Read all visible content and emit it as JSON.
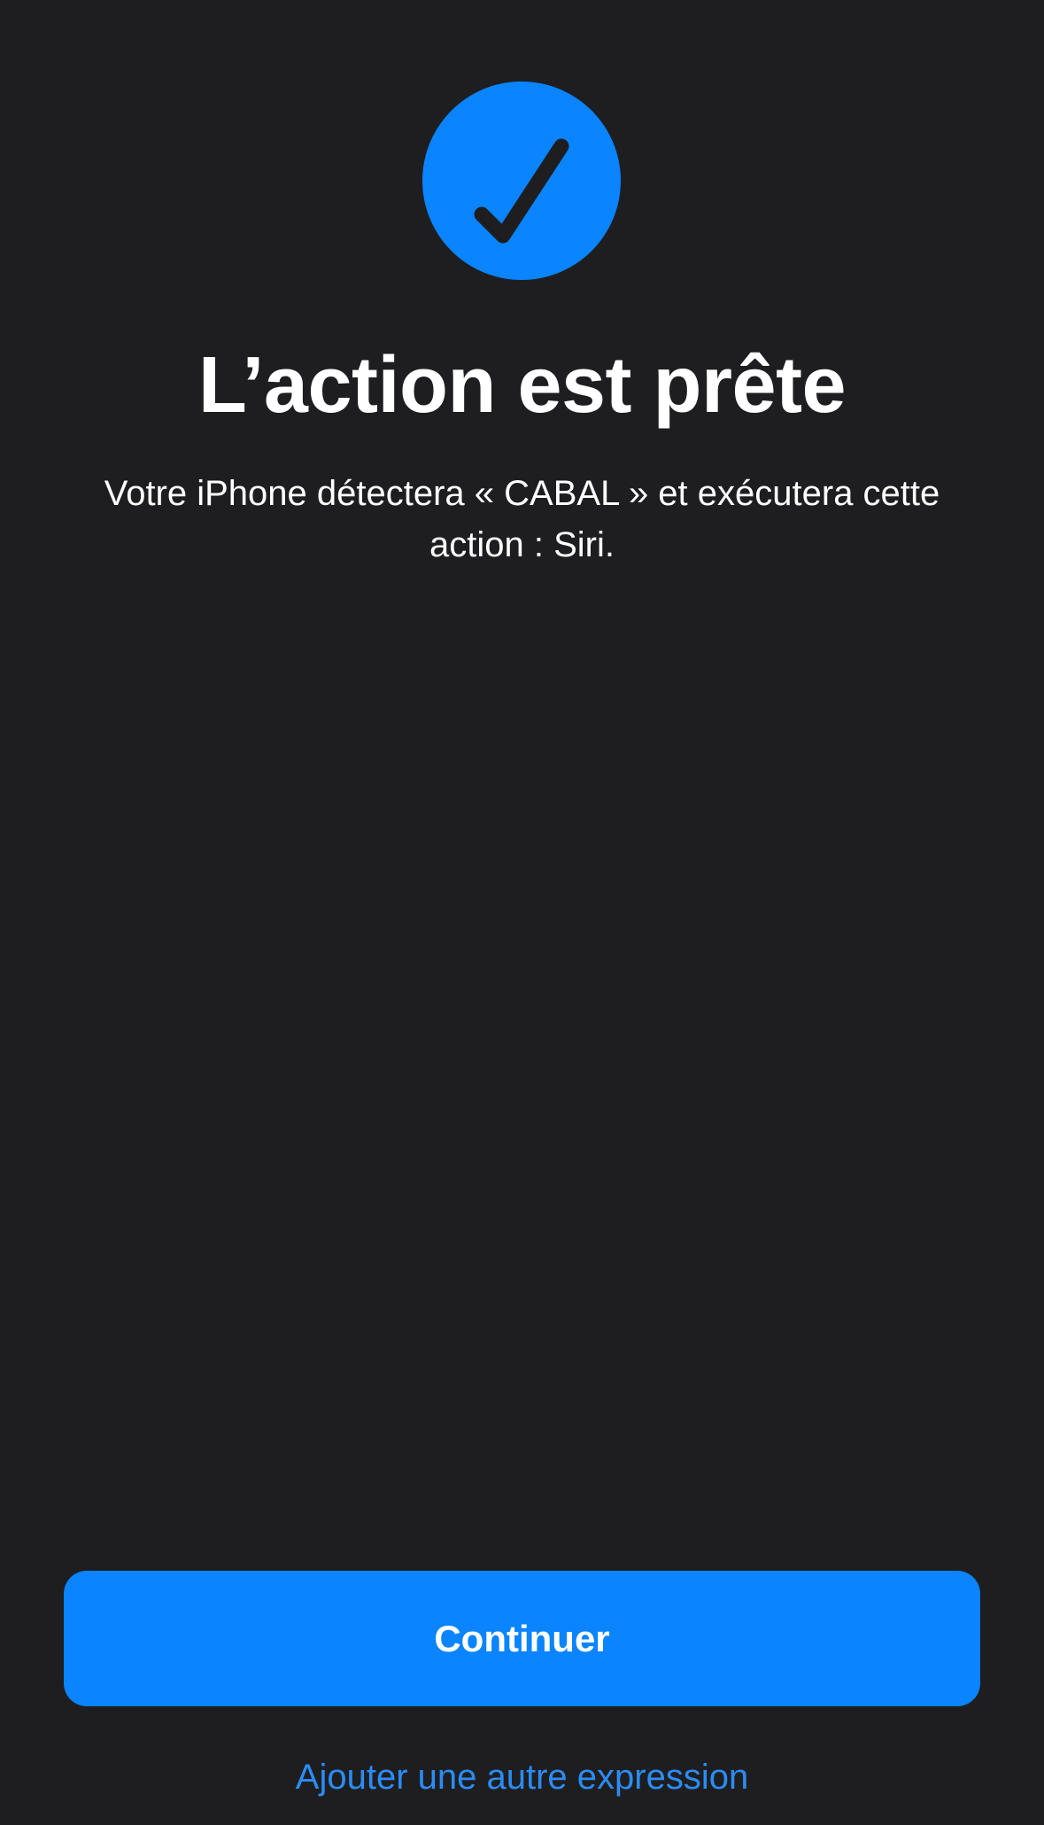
{
  "header": {
    "icon": "checkmark-circle-icon",
    "accent_color": "#0a84ff"
  },
  "main": {
    "title": "L’action est prête",
    "description": "Votre iPhone détectera « CABAL » et exécutera cette action : Siri."
  },
  "footer": {
    "continue_label": "Continuer",
    "add_phrase_label": "Ajouter une autre expression"
  }
}
